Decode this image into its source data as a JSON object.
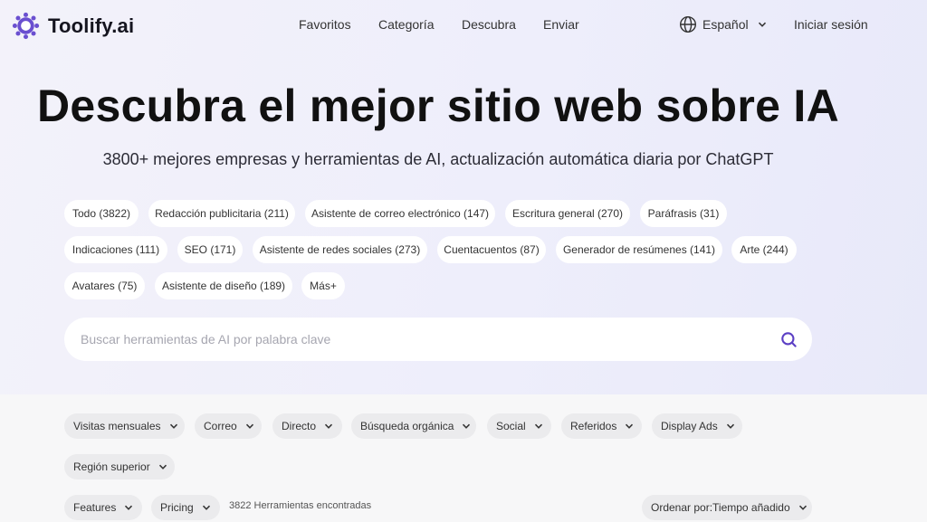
{
  "header": {
    "logo_text": "Toolify.ai",
    "nav": [
      "Favoritos",
      "Categoría",
      "Descubra",
      "Enviar"
    ],
    "language": "Español",
    "login": "Iniciar sesión"
  },
  "hero": {
    "title": "Descubra el mejor sitio web sobre IA",
    "subtitle": "3800+ mejores empresas y herramientas de AI, actualización automática diaria por ChatGPT"
  },
  "categories": [
    "Todo (3822)",
    "Redacción publicitaria (211)",
    "Asistente de correo electrónico (147)",
    "Escritura general (270)",
    "Paráfrasis (31)",
    "Indicaciones (111)",
    "SEO (171)",
    "Asistente de redes sociales (273)",
    "Cuentacuentos (87)",
    "Generador de resúmenes (141)",
    "Arte (244)",
    "Avatares (75)",
    "Asistente de diseño (189)",
    "Más+"
  ],
  "search": {
    "placeholder": "Buscar herramientas de AI por palabra clave",
    "value": ""
  },
  "filters": {
    "row1": [
      "Visitas mensuales",
      "Correo",
      "Directo",
      "Búsqueda orgánica",
      "Social",
      "Referidos",
      "Display Ads"
    ],
    "row2": [
      "Región superior"
    ],
    "row3": [
      "Features",
      "Pricing"
    ],
    "result_count": "3822 Herramientas encontradas",
    "sort": "Ordenar por:Tiempo añadido"
  },
  "colors": {
    "accent": "#6a4fd0",
    "hero_bg": "#eeeefb",
    "chip_bg": "#ffffff",
    "filter_bg": "#ebebed"
  }
}
